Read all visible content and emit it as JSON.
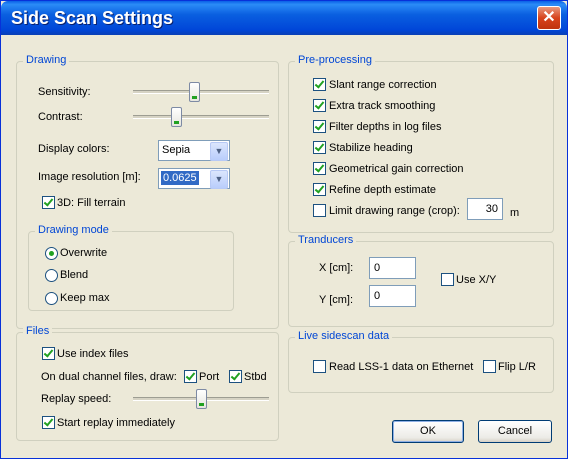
{
  "window": {
    "title": "Side Scan Settings",
    "close_glyph": "✕"
  },
  "drawing": {
    "legend": "Drawing",
    "sensitivity_label": "Sensitivity:",
    "sensitivity_level": 0.45,
    "contrast_label": "Contrast:",
    "contrast_level": 0.3,
    "display_colors_label": "Display colors:",
    "display_colors_value": "Sepia",
    "image_resolution_label": "Image resolution [m]:",
    "image_resolution_value": "0.0625",
    "fill_terrain_label": "3D: Fill terrain",
    "fill_terrain_checked": true
  },
  "drawing_mode": {
    "legend": "Drawing mode",
    "options": [
      {
        "label": "Overwrite",
        "checked": true
      },
      {
        "label": "Blend",
        "checked": false
      },
      {
        "label": "Keep max",
        "checked": false
      }
    ]
  },
  "files": {
    "legend": "Files",
    "use_index_label": "Use index files",
    "use_index_checked": true,
    "dual_channel_label": "On dual channel files, draw:",
    "port_label": "Port",
    "port_checked": true,
    "stbd_label": "Stbd",
    "stbd_checked": true,
    "replay_speed_label": "Replay speed:",
    "replay_speed_level": 0.5,
    "start_replay_label": "Start replay immediately",
    "start_replay_checked": true
  },
  "preprocessing": {
    "legend": "Pre-processing",
    "options": [
      {
        "label": "Slant range correction",
        "checked": true
      },
      {
        "label": "Extra track smoothing",
        "checked": true
      },
      {
        "label": "Filter depths in log files",
        "checked": true
      },
      {
        "label": "Stabilize heading",
        "checked": true
      },
      {
        "label": "Geometrical gain correction",
        "checked": true
      },
      {
        "label": "Refine depth estimate",
        "checked": true
      }
    ],
    "limit_range_label": "Limit drawing range (crop):",
    "limit_range_checked": false,
    "limit_range_value": "30",
    "limit_range_unit": "m"
  },
  "transducers": {
    "legend": "Tranducers",
    "x_label": "X [cm]:",
    "x_value": "0",
    "y_label": "Y [cm]:",
    "y_value": "0",
    "use_xy_label": "Use X/Y",
    "use_xy_checked": false
  },
  "live": {
    "legend": "Live sidescan data",
    "read_lss_label": "Read LSS-1 data on Ethernet",
    "read_lss_checked": false,
    "flip_label": "Flip L/R",
    "flip_checked": false
  },
  "buttons": {
    "ok": "OK",
    "cancel": "Cancel"
  }
}
